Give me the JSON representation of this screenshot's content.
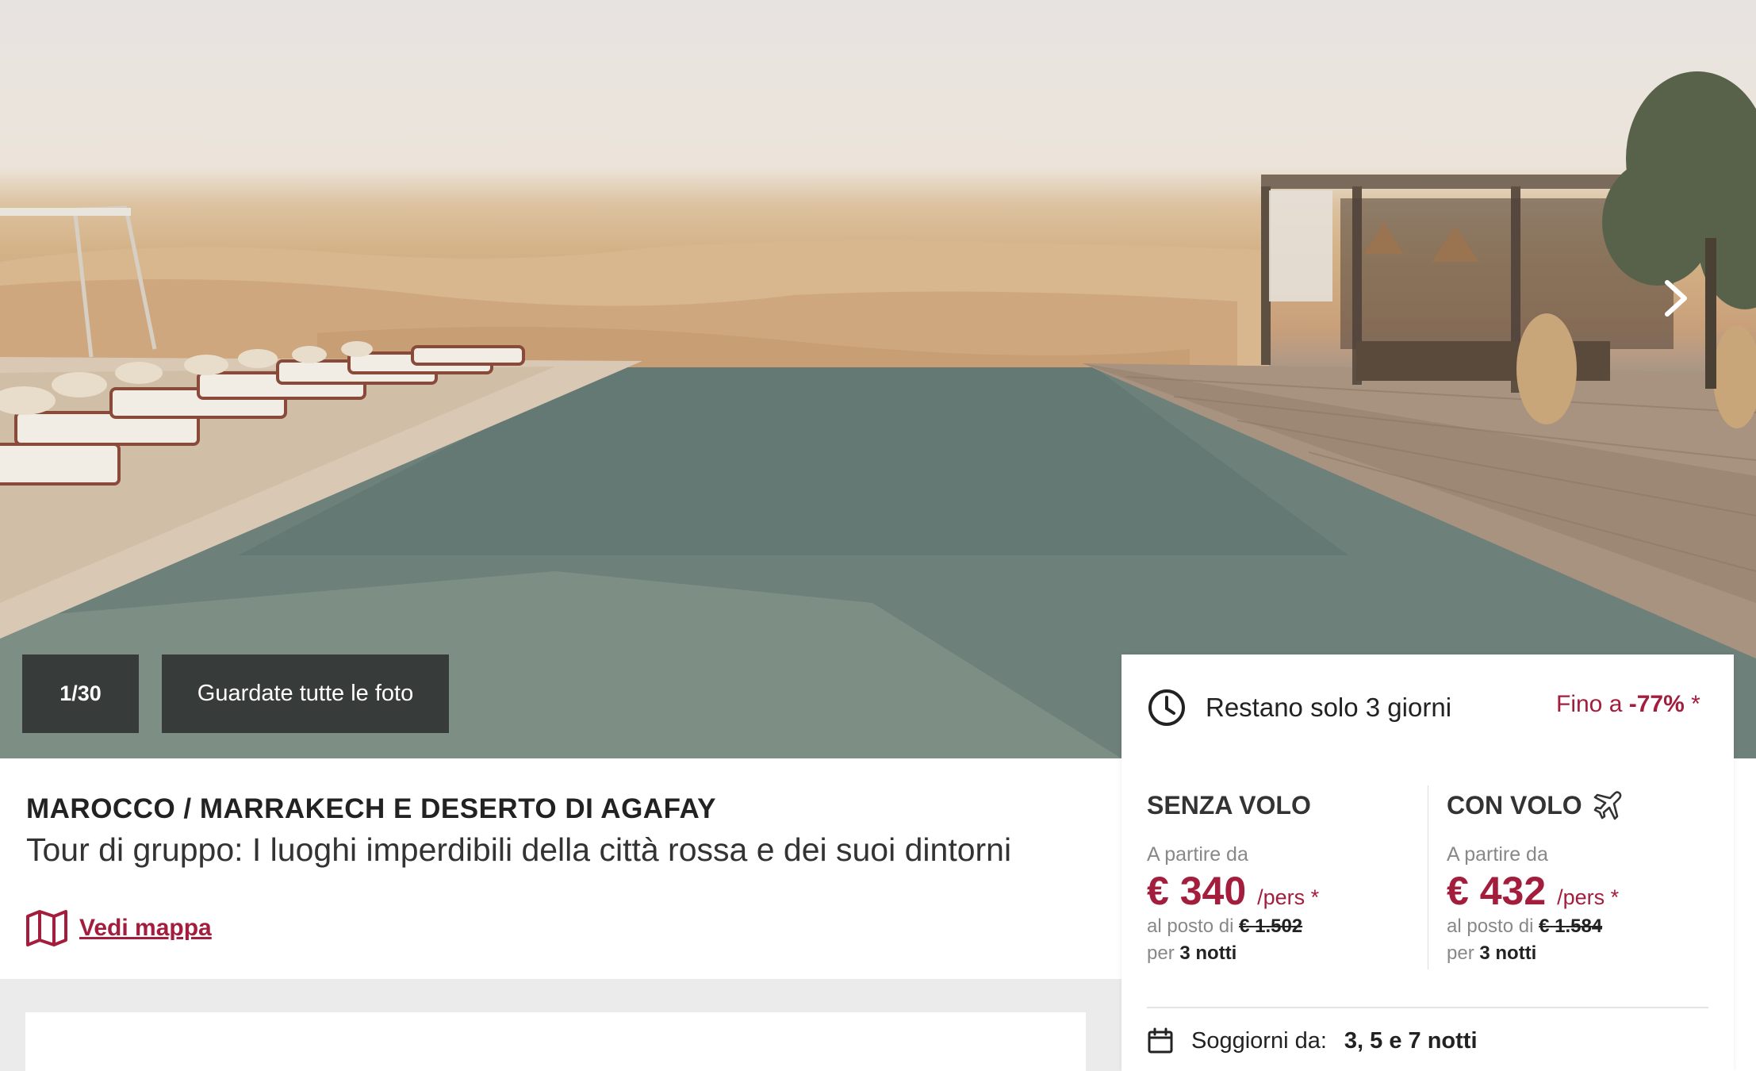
{
  "hero": {
    "photo_counter": "1/30",
    "all_photos_label": "Guardate tutte le foto",
    "next_icon": "chevron-right-icon"
  },
  "listing": {
    "region": "MAROCCO / MARRAKECH E DESERTO DI AGAFAY",
    "subtitle": "Tour di gruppo: I luoghi imperdibili della città rossa e dei suoi dintorni",
    "map_link_label": "Vedi mappa",
    "map_icon": "map-icon"
  },
  "offer": {
    "countdown_label": "Restano solo 3 giorni",
    "clock_icon": "clock-icon",
    "discount_prefix": "Fino a",
    "discount_value": "-77%",
    "discount_suffix": "*",
    "accent_color": "#a31d3c"
  },
  "pricing": {
    "without_flight": {
      "heading": "SENZA VOLO",
      "from_label": "A partire da",
      "price": "€ 340",
      "per": "/pers *",
      "instead_label": "al posto di",
      "old_price": "€ 1.502",
      "nights_label": "per",
      "nights_value": "3 notti"
    },
    "with_flight": {
      "heading": "CON VOLO",
      "icon": "plane-icon",
      "from_label": "A partire da",
      "price": "€ 432",
      "per": "/pers *",
      "instead_label": "al posto di",
      "old_price": "€ 1.584",
      "nights_label": "per",
      "nights_value": "3 notti"
    }
  },
  "stays": {
    "icon": "calendar-icon",
    "label": "Soggiorni da:",
    "value": "3, 5 e 7 notti"
  }
}
